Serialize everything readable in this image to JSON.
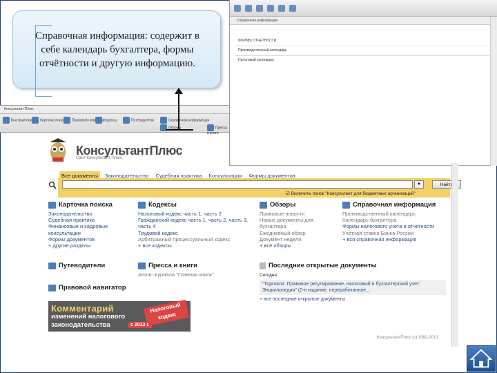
{
  "callout": {
    "text": "Справочная информация: содержит в себе календарь бухгалтера, формы отчётности и другую информацию."
  },
  "inset_right": {
    "section_title": "Справочная информация",
    "rows": [
      {
        "left": "ФОРМЫ ОТЧЕТНОСТИ",
        "right": ""
      },
      {
        "left": "Производственный календарь",
        "right": ""
      },
      {
        "left": "Налоговый календарь",
        "right": ""
      }
    ]
  },
  "inset_left": {
    "toolbar_top": "Консультант Плюс",
    "buttons": [
      "Быстрый поиск",
      "Карточка поиска",
      "Правовой навигатор",
      "Кодексы",
      "Путеводители",
      "Справочная информация",
      "Обзоры",
      "Пресса и книги"
    ]
  },
  "page": {
    "logo_title": "КонсультантПлюс",
    "logo_sub": "Сайт Консультант Плюс",
    "tabs": [
      "Все документы",
      "Законодательство",
      "Судебная практика",
      "Консультации",
      "Формы документов"
    ],
    "search_placeholder": "",
    "search_button": "Найти",
    "search_dropdown": "▼",
    "checkbox_label": "Включить поиск \"Консультант для бюджетных организаций\"",
    "col1": {
      "title": "Карточка поиска",
      "links": [
        "Законодательство",
        "Судебная практика",
        "Финансовые и кадровые консультации",
        "Формы документов"
      ],
      "more": "+ другие разделы"
    },
    "col2": {
      "title": "Кодексы",
      "links": [
        "Налоговый кодекс часть 1, часть 2",
        "Гражданский кодекс часть 1, часть 2, часть 3, часть 4",
        "Трудовой кодекс",
        "Арбитражный процессуальный кодекс"
      ],
      "more": "+ все кодексы"
    },
    "col3": {
      "title": "Обзоры",
      "links": [
        "Правовые новости",
        "Новые документы для бухгалтера",
        "Ежедневный обзор",
        "Документ недели"
      ],
      "more": "+ все обзоры"
    },
    "col4": {
      "title": "Справочная информация",
      "links": [
        "Производственный календарь",
        "Календарь бухгалтера",
        "Формы налогового учета и отчетности",
        "Учетная ставка Банка России"
      ],
      "more": "+ вся справочная информация"
    },
    "guides": {
      "title": "Путеводители"
    },
    "press": {
      "title": "Пресса и книги",
      "sub": "Анонс журнала \"Главная книга\""
    },
    "navigator": {
      "title": "Правовой навигатор"
    },
    "recent": {
      "title": "Последние открытые документы",
      "today": "Сегодня:",
      "item": "\"Торговля: Правовое регулирование, налоговый и бухгалтерский учет: Энциклопедия\" (2-е издание, переработанное...",
      "more": "+ все последние открытые документы"
    },
    "banner": {
      "line1": "Комментарий",
      "line2": "изменений налогового",
      "line3": "законодательства",
      "badge": "Налоговый кодекс",
      "year": "с 2013 г."
    },
    "footer": "КонсультантПлюс (c) 1992-2012"
  }
}
